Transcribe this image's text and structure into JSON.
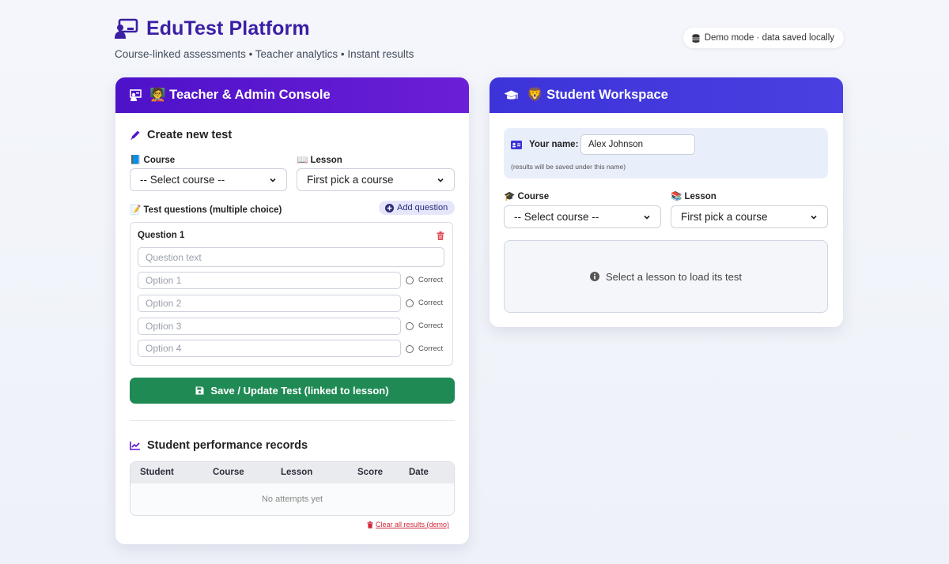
{
  "header": {
    "title": "EduTest Platform",
    "subtitle": "Course-linked assessments • Teacher analytics • Instant results",
    "demo_badge": "Demo mode · data saved locally"
  },
  "teacher": {
    "title": "🧑‍🏫 Teacher & Admin Console",
    "create_title": "Create new test",
    "course_label": "📘 Course",
    "course_value": "-- Select course --",
    "lesson_label": "📖 Lesson",
    "lesson_value": "First pick a course",
    "questions_label": "📝 Test questions (multiple choice)",
    "add_question": "Add question",
    "question": {
      "title": "Question 1",
      "text_placeholder": "Question text",
      "options": [
        {
          "placeholder": "Option 1",
          "correct_label": "Correct"
        },
        {
          "placeholder": "Option 2",
          "correct_label": "Correct"
        },
        {
          "placeholder": "Option 3",
          "correct_label": "Correct"
        },
        {
          "placeholder": "Option 4",
          "correct_label": "Correct"
        }
      ]
    },
    "save_button": "Save / Update Test (linked to lesson)",
    "records_title": "Student performance records",
    "table": {
      "columns": [
        "Student",
        "Course",
        "Lesson",
        "Score",
        "Date"
      ],
      "empty": "No attempts yet"
    },
    "clear_link": "Clear all results (demo)"
  },
  "student": {
    "title": "🦁 Student Workspace",
    "name_label": "Your name:",
    "name_value": "Alex Johnson",
    "name_hint": "(results will be saved under this name)",
    "course_label": "🎓 Course",
    "course_value": "-- Select course --",
    "lesson_label": "📚 Lesson",
    "lesson_value": "First pick a course",
    "placeholder_text": "Select a lesson to load its test"
  },
  "colors": {
    "brand": "#3b1fa3",
    "teacher_header": "#5a16cf",
    "student_header": "#4038dc",
    "save_button": "#208a55",
    "danger": "#d0283b"
  }
}
